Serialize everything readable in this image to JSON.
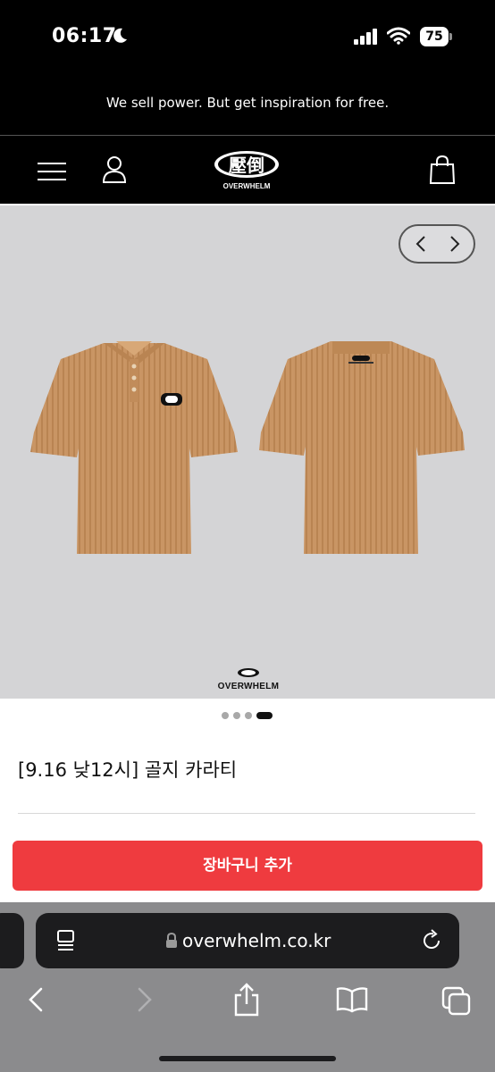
{
  "status_bar": {
    "time": "06:17",
    "battery": "75"
  },
  "promo": {
    "text": "We sell power. But get inspiration for free."
  },
  "nav": {
    "logo_text": "OVERWHELM",
    "logo_mark": "壓倒",
    "icons": [
      "menu-icon",
      "user-icon",
      "shopping-bag-icon"
    ]
  },
  "hero": {
    "brand_text": "OVERWHELM",
    "carousel_prev": "chevron-left-icon",
    "carousel_next": "chevron-right-icon",
    "image_count": 4,
    "active_image": 4,
    "shirt_color": "#c99564"
  },
  "product": {
    "title": "[9.16 낮12시] 골지 카라티"
  },
  "actions": {
    "add_to_cart": "장바구니 추가",
    "button_color": "#ef3b3f"
  },
  "browser": {
    "url": "overwhelm.co.kr",
    "icons": [
      "reader-icon",
      "lock-icon",
      "reload-icon",
      "back-icon",
      "forward-icon",
      "share-icon",
      "bookmarks-icon",
      "tabs-icon"
    ]
  }
}
